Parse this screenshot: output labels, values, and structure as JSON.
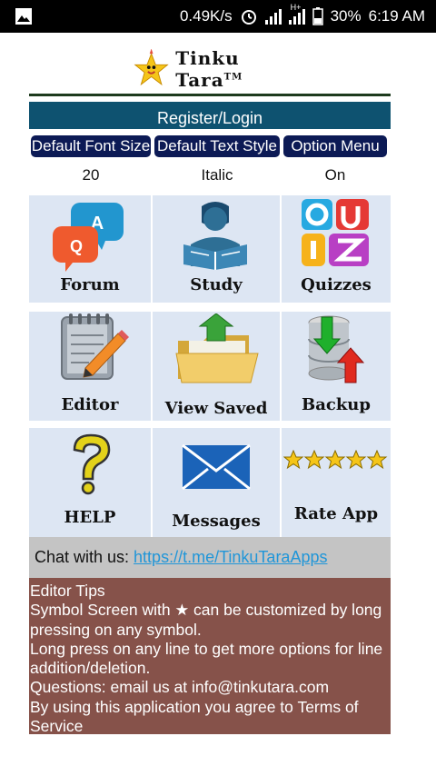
{
  "status_bar": {
    "speed": "0.49K/s",
    "battery": "30%",
    "time": "6:19 AM",
    "network": "H+"
  },
  "header": {
    "app_name": "Tinku Tara",
    "tm": "TM"
  },
  "register_label": "Register/Login",
  "options": [
    {
      "label": "Default Font Size",
      "value": "20"
    },
    {
      "label": "Default Text Style",
      "value": "Italic"
    },
    {
      "label": "Option Menu",
      "value": "On"
    }
  ],
  "tiles": {
    "forum": "Forum",
    "study": "Study",
    "quizzes": "Quizzes",
    "editor": "Editor",
    "view_saved": "View Saved",
    "backup": "Backup",
    "help": "HELP",
    "messages": "Messages",
    "rate_app": "Rate App"
  },
  "chat": {
    "prefix": "Chat with us: ",
    "link": "https://t.me/TinkuTaraApps"
  },
  "tips": {
    "title": "Editor Tips",
    "line1": "Symbol Screen with ★ can be customized by long pressing on any symbol.",
    "line2": "Long press on any line to get more options for line addition/deletion.",
    "line3": "Questions: email us at info@tinkutara.com",
    "line4": "By using this application you agree to Terms of Service"
  },
  "icon_letters": {
    "q": "Q",
    "a": "A"
  },
  "colors": {
    "register_bg": "#0e5270",
    "button_bg": "#0c1a55",
    "tile_bg": "#dde6f3",
    "chat_bg": "#c4c4c4",
    "tips_bg": "#86524a",
    "link": "#2196d8"
  }
}
